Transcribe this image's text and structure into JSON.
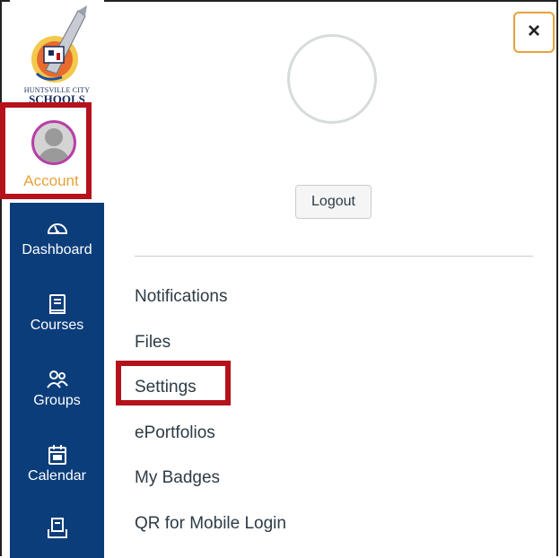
{
  "logo": {
    "line1": "HUNTSVILLE CITY",
    "line2": "SCHOOLS"
  },
  "nav": {
    "account_label": "Account",
    "items": [
      {
        "label": "Dashboard",
        "icon": "dashboard-icon"
      },
      {
        "label": "Courses",
        "icon": "courses-icon"
      },
      {
        "label": "Groups",
        "icon": "groups-icon"
      },
      {
        "label": "Calendar",
        "icon": "calendar-icon"
      },
      {
        "label": "",
        "icon": "inbox-icon"
      }
    ]
  },
  "tray": {
    "close_label": "×",
    "logout_label": "Logout",
    "links": [
      "Notifications",
      "Files",
      "Settings",
      "ePortfolios",
      "My Badges",
      "QR for Mobile Login"
    ]
  },
  "colors": {
    "nav_bg": "#0b3d7a",
    "highlight": "#b5121b",
    "accent": "#e8a23a",
    "avatar_ring": "#b73fa6"
  }
}
